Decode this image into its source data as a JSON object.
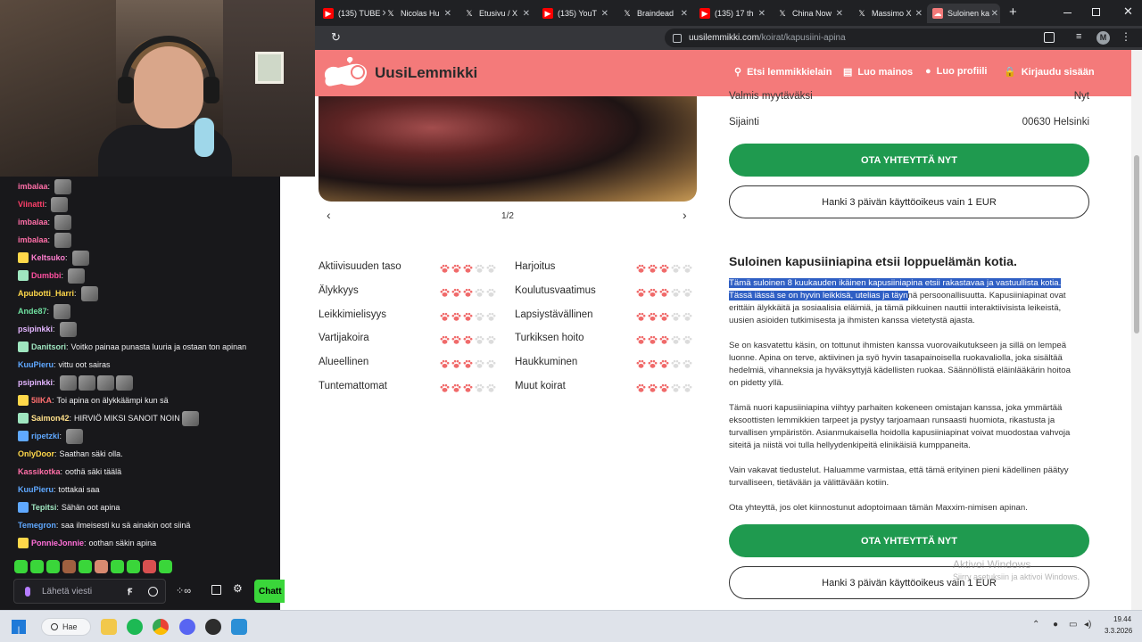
{
  "chat": {
    "messages": [
      {
        "name": "imbalaa",
        "color": "#ff6fa8",
        "text": "",
        "emotes": 1
      },
      {
        "name": "Viinatti",
        "color": "#ff3f6a",
        "text": "",
        "emotes": 1
      },
      {
        "name": "imbalaa",
        "color": "#ff6fa8",
        "text": "",
        "emotes": 1
      },
      {
        "name": "imbalaa",
        "color": "#ff6fa8",
        "text": "",
        "emotes": 1
      },
      {
        "name": "Keltsuko",
        "color": "#ff7fd0",
        "text": "",
        "emotes": 1
      },
      {
        "name": "Dumbbi",
        "color": "#ff4fa0",
        "text": "",
        "emotes": 1
      },
      {
        "name": "Apubotti_Harri",
        "color": "#ffd84a",
        "text": "",
        "emotes": 1
      },
      {
        "name": "Ande87",
        "color": "#6fe0a0",
        "text": "",
        "emotes": 1
      },
      {
        "name": "psipinkki",
        "color": "#e3b5ff",
        "text": "",
        "emotes": 1
      },
      {
        "name": "Danitsori",
        "color": "#9fe6c0",
        "text": "Voitko painaa punasta luuria ja ostaan ton apinan",
        "emotes": 0
      },
      {
        "name": "KuuPieru",
        "color": "#5fa8ff",
        "text": "vittu oot sairas",
        "emotes": 0
      },
      {
        "name": "psipinkki",
        "color": "#e3b5ff",
        "text": "",
        "emotes": 4
      },
      {
        "name": "5IIKA",
        "color": "#ff6f6f",
        "text": "Toi apina on älykkäämpi kun sä",
        "emotes": 0
      },
      {
        "name": "Saimon42",
        "color": "#ffe08a",
        "text": "HIRVIÖ MIKSI SANOIT NOIN",
        "emotes": 1
      },
      {
        "name": "ripetzki",
        "color": "#5fa8ff",
        "text": "",
        "emotes": 1
      },
      {
        "name": "OnlyDoor",
        "color": "#ffd84a",
        "text": "Saathan säki olla.",
        "emotes": 0
      },
      {
        "name": "Kassikotka",
        "color": "#ff6fa8",
        "text": "oothä säki täälä",
        "emotes": 0
      },
      {
        "name": "KuuPieru",
        "color": "#5fa8ff",
        "text": "tottakai saa",
        "emotes": 0
      },
      {
        "name": "Tepitsi",
        "color": "#9fe6c0",
        "text": "Sähän oot apina",
        "emotes": 0
      },
      {
        "name": "Temegron",
        "color": "#5fa8ff",
        "text": "saa ilmeisesti ku sä ainakin oot siinä",
        "emotes": 0
      },
      {
        "name": "PonnieJonnie",
        "color": "#ff6fd8",
        "text": "oothan säkin apina",
        "emotes": 0
      }
    ],
    "input_placeholder": "Lähetä viesti",
    "send_label": "Chatt"
  },
  "browser": {
    "tabs": [
      {
        "label": "(135) TUBE",
        "icon": "youtube-icon"
      },
      {
        "label": "Nicolas Hu",
        "icon": "x-icon"
      },
      {
        "label": "Etusivu / X",
        "icon": "x-icon"
      },
      {
        "label": "(135) YouT",
        "icon": "youtube-icon"
      },
      {
        "label": "Braindead",
        "icon": "x-icon"
      },
      {
        "label": "(135) 17 th",
        "icon": "youtube-icon"
      },
      {
        "label": "China Now",
        "icon": "x-icon"
      },
      {
        "label": "Massimo X",
        "icon": "x-icon"
      },
      {
        "label": "Suloinen ka",
        "icon": "site-icon"
      }
    ],
    "url_domain": "uusilemmikki.com",
    "url_path": "/koirat/kapusiini-apina",
    "profile_initial": "M"
  },
  "site": {
    "logo": "UusiLemmikki",
    "nav": [
      {
        "label": "Etsi lemmikkielain",
        "icon": "search-icon"
      },
      {
        "label": "Luo mainos",
        "icon": "document-icon"
      },
      {
        "label": "Luo profiili",
        "icon": "user-icon"
      },
      {
        "label": "Kirjaudu sisään",
        "icon": "lock-icon"
      }
    ],
    "pager": "1/2",
    "traits": [
      {
        "label": "Aktiivisuuden taso",
        "level": 3
      },
      {
        "label": "Älykkyys",
        "level": 3
      },
      {
        "label": "Leikkimielisyys",
        "level": 3
      },
      {
        "label": "Vartijakoira",
        "level": 3
      },
      {
        "label": "Alueellinen",
        "level": 3
      },
      {
        "label": "Tuntemattomat",
        "level": 3
      },
      {
        "label": "Harjoitus",
        "level": 3
      },
      {
        "label": "Koulutusvaatimus",
        "level": 3
      },
      {
        "label": "Lapsiystävällinen",
        "level": 3
      },
      {
        "label": "Turkiksen hoito",
        "level": 3
      },
      {
        "label": "Haukkuminen",
        "level": 3
      },
      {
        "label": "Muut koirat",
        "level": 3
      }
    ],
    "info": [
      {
        "key": "Valmis myytäväksi",
        "value": "Nyt"
      },
      {
        "key": "Sijainti",
        "value": "00630 Helsinki"
      }
    ],
    "cta_primary": "OTA YHTEYTTÄ NYT",
    "cta_secondary": "Hanki 3 päivän käyttöoikeus vain 1 EUR",
    "heading": "Suloinen kapusiiniapina etsii loppuelämän kotia.",
    "desc_highlight": "Tämä suloinen 8 kuukauden ikäinen kapusiiniapina etsii rakastavaa ja vastuullista kotia. Tässä iässä se on hyvin leikkisä, utelias ja täyn",
    "desc_rest": "nä persoonallisuutta. Kapusiiniapinat ovat erittäin älykkäitä ja sosiaalisia eläimiä, ja tämä pikkuinen nauttii interaktiivisista leikeistä, uusien asioiden tutkimisesta ja ihmisten kanssa vietetystä ajasta.",
    "paragraphs": [
      "Se on kasvatettu käsin, on tottunut ihmisten kanssa vuorovaikutukseen ja sillä on lempeä luonne. Apina on terve, aktiivinen ja syö hyvin tasapainoisella ruokavaliolla, joka sisältää hedelmiä, vihanneksia ja hyväksyttyjä kädellisten ruokaa. Säännöllistä eläinlääkärin hoitoa on pidetty yllä.",
      "Tämä nuori kapusiiniapina viihtyy parhaiten kokeneen omistajan kanssa, joka ymmärtää eksoottisten lemmikkien tarpeet ja pystyy tarjoamaan runsaasti huomiota, rikastusta ja turvallisen ympäristön. Asianmukaisella hoidolla kapusiiniapinat voivat muodostaa vahvoja siteitä ja niistä voi tulla hellyydenkipeitä elinikäisiä kumppaneita.",
      "Vain vakavat tiedustelut. Haluamme varmistaa, että tämä erityinen pieni kädellinen päätyy turvalliseen, tietävään ja välittävään kotiin.",
      "Ota yhteyttä, jos olet kiinnostunut adoptoimaan tämän Maxxim-nimisen apinan."
    ],
    "watermark_title": "Aktivoi Windows",
    "watermark_sub": "Siirry asetuksiin ja aktivoi Windows."
  },
  "taskbar": {
    "search_label": "Hae",
    "time": "19.44",
    "date": "3.3.2026"
  }
}
